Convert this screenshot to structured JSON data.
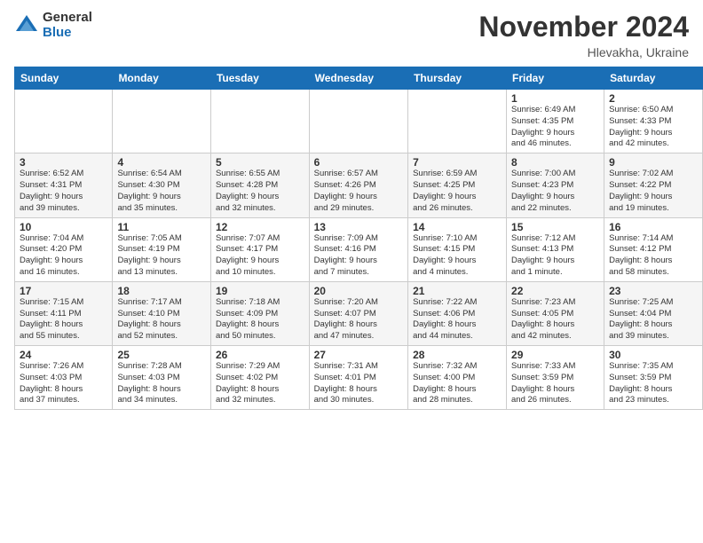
{
  "logo": {
    "general": "General",
    "blue": "Blue"
  },
  "title": "November 2024",
  "location": "Hlevakha, Ukraine",
  "days_header": [
    "Sunday",
    "Monday",
    "Tuesday",
    "Wednesday",
    "Thursday",
    "Friday",
    "Saturday"
  ],
  "weeks": [
    [
      {
        "day": "",
        "info": ""
      },
      {
        "day": "",
        "info": ""
      },
      {
        "day": "",
        "info": ""
      },
      {
        "day": "",
        "info": ""
      },
      {
        "day": "",
        "info": ""
      },
      {
        "day": "1",
        "info": "Sunrise: 6:49 AM\nSunset: 4:35 PM\nDaylight: 9 hours\nand 46 minutes."
      },
      {
        "day": "2",
        "info": "Sunrise: 6:50 AM\nSunset: 4:33 PM\nDaylight: 9 hours\nand 42 minutes."
      }
    ],
    [
      {
        "day": "3",
        "info": "Sunrise: 6:52 AM\nSunset: 4:31 PM\nDaylight: 9 hours\nand 39 minutes."
      },
      {
        "day": "4",
        "info": "Sunrise: 6:54 AM\nSunset: 4:30 PM\nDaylight: 9 hours\nand 35 minutes."
      },
      {
        "day": "5",
        "info": "Sunrise: 6:55 AM\nSunset: 4:28 PM\nDaylight: 9 hours\nand 32 minutes."
      },
      {
        "day": "6",
        "info": "Sunrise: 6:57 AM\nSunset: 4:26 PM\nDaylight: 9 hours\nand 29 minutes."
      },
      {
        "day": "7",
        "info": "Sunrise: 6:59 AM\nSunset: 4:25 PM\nDaylight: 9 hours\nand 26 minutes."
      },
      {
        "day": "8",
        "info": "Sunrise: 7:00 AM\nSunset: 4:23 PM\nDaylight: 9 hours\nand 22 minutes."
      },
      {
        "day": "9",
        "info": "Sunrise: 7:02 AM\nSunset: 4:22 PM\nDaylight: 9 hours\nand 19 minutes."
      }
    ],
    [
      {
        "day": "10",
        "info": "Sunrise: 7:04 AM\nSunset: 4:20 PM\nDaylight: 9 hours\nand 16 minutes."
      },
      {
        "day": "11",
        "info": "Sunrise: 7:05 AM\nSunset: 4:19 PM\nDaylight: 9 hours\nand 13 minutes."
      },
      {
        "day": "12",
        "info": "Sunrise: 7:07 AM\nSunset: 4:17 PM\nDaylight: 9 hours\nand 10 minutes."
      },
      {
        "day": "13",
        "info": "Sunrise: 7:09 AM\nSunset: 4:16 PM\nDaylight: 9 hours\nand 7 minutes."
      },
      {
        "day": "14",
        "info": "Sunrise: 7:10 AM\nSunset: 4:15 PM\nDaylight: 9 hours\nand 4 minutes."
      },
      {
        "day": "15",
        "info": "Sunrise: 7:12 AM\nSunset: 4:13 PM\nDaylight: 9 hours\nand 1 minute."
      },
      {
        "day": "16",
        "info": "Sunrise: 7:14 AM\nSunset: 4:12 PM\nDaylight: 8 hours\nand 58 minutes."
      }
    ],
    [
      {
        "day": "17",
        "info": "Sunrise: 7:15 AM\nSunset: 4:11 PM\nDaylight: 8 hours\nand 55 minutes."
      },
      {
        "day": "18",
        "info": "Sunrise: 7:17 AM\nSunset: 4:10 PM\nDaylight: 8 hours\nand 52 minutes."
      },
      {
        "day": "19",
        "info": "Sunrise: 7:18 AM\nSunset: 4:09 PM\nDaylight: 8 hours\nand 50 minutes."
      },
      {
        "day": "20",
        "info": "Sunrise: 7:20 AM\nSunset: 4:07 PM\nDaylight: 8 hours\nand 47 minutes."
      },
      {
        "day": "21",
        "info": "Sunrise: 7:22 AM\nSunset: 4:06 PM\nDaylight: 8 hours\nand 44 minutes."
      },
      {
        "day": "22",
        "info": "Sunrise: 7:23 AM\nSunset: 4:05 PM\nDaylight: 8 hours\nand 42 minutes."
      },
      {
        "day": "23",
        "info": "Sunrise: 7:25 AM\nSunset: 4:04 PM\nDaylight: 8 hours\nand 39 minutes."
      }
    ],
    [
      {
        "day": "24",
        "info": "Sunrise: 7:26 AM\nSunset: 4:03 PM\nDaylight: 8 hours\nand 37 minutes."
      },
      {
        "day": "25",
        "info": "Sunrise: 7:28 AM\nSunset: 4:03 PM\nDaylight: 8 hours\nand 34 minutes."
      },
      {
        "day": "26",
        "info": "Sunrise: 7:29 AM\nSunset: 4:02 PM\nDaylight: 8 hours\nand 32 minutes."
      },
      {
        "day": "27",
        "info": "Sunrise: 7:31 AM\nSunset: 4:01 PM\nDaylight: 8 hours\nand 30 minutes."
      },
      {
        "day": "28",
        "info": "Sunrise: 7:32 AM\nSunset: 4:00 PM\nDaylight: 8 hours\nand 28 minutes."
      },
      {
        "day": "29",
        "info": "Sunrise: 7:33 AM\nSunset: 3:59 PM\nDaylight: 8 hours\nand 26 minutes."
      },
      {
        "day": "30",
        "info": "Sunrise: 7:35 AM\nSunset: 3:59 PM\nDaylight: 8 hours\nand 23 minutes."
      }
    ]
  ]
}
